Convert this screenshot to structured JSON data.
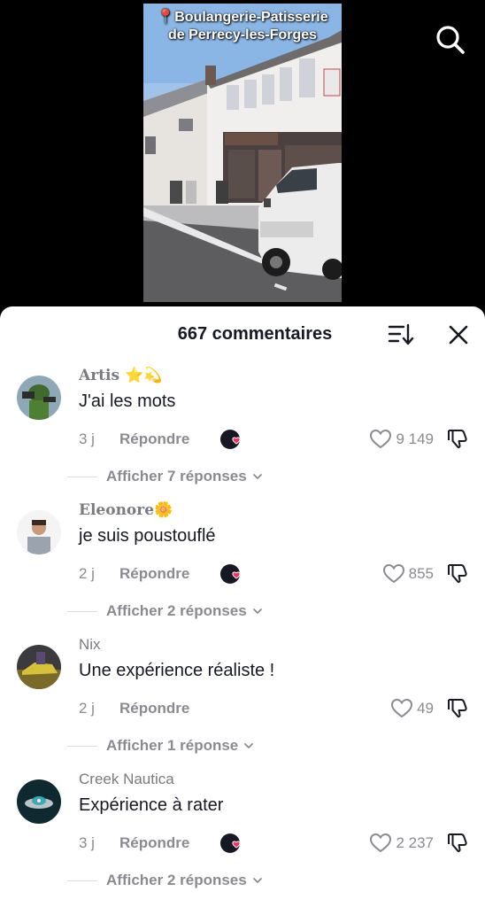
{
  "video": {
    "caption_line1": "📍Boulangerie-Patisserie",
    "caption_line2": "de Perrecy-les-Forges"
  },
  "icons": {
    "search": "search-icon",
    "sort": "sort-icon",
    "close": "close-icon",
    "heart": "heart-icon",
    "dislike": "thumbs-down-icon",
    "creator_liked": "creator-liked-icon",
    "chevron": "chevron-down-icon"
  },
  "colors": {
    "creator_heart": "#fe2c55",
    "text_primary": "#161823",
    "text_secondary": "#8a8b91"
  },
  "comments_header": {
    "title": "667 commentaires"
  },
  "comments": [
    {
      "username": "Artis ⭐💫",
      "text": "J'ai les mots",
      "time": "3 j",
      "reply_label": "Répondre",
      "creator_liked": true,
      "likes": "9 149",
      "view_replies": "Afficher 7 réponses"
    },
    {
      "username": "Eleonore🌼",
      "text": "je suis poustouflé",
      "time": "2 j",
      "reply_label": "Répondre",
      "creator_liked": true,
      "likes": "855",
      "view_replies": "Afficher 2 réponses"
    },
    {
      "username": "Nix",
      "text": "Une expérience réaliste !",
      "time": "2 j",
      "reply_label": "Répondre",
      "creator_liked": false,
      "likes": "49",
      "view_replies": "Afficher 1 réponse"
    },
    {
      "username": "Creek Nautica",
      "text": "Expérience à rater",
      "time": "3 j",
      "reply_label": "Répondre",
      "creator_liked": true,
      "likes": "2 237",
      "view_replies": "Afficher 2 réponses"
    }
  ]
}
